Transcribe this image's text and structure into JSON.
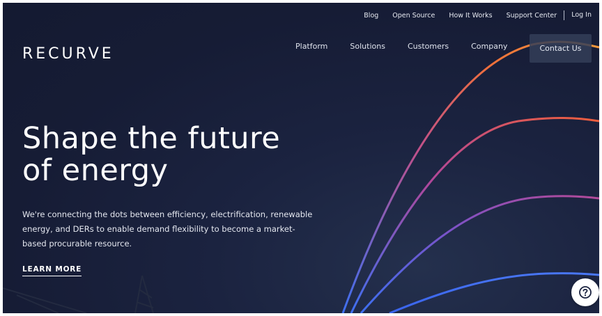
{
  "brand": {
    "logo_text": "RECURVE"
  },
  "utility_nav": {
    "items": [
      {
        "label": "Blog"
      },
      {
        "label": "Open Source"
      },
      {
        "label": "How It Works"
      },
      {
        "label": "Support Center"
      }
    ],
    "login_label": "Log In"
  },
  "main_nav": {
    "items": [
      {
        "label": "Platform"
      },
      {
        "label": "Solutions"
      },
      {
        "label": "Customers"
      },
      {
        "label": "Company"
      }
    ],
    "contact_label": "Contact Us"
  },
  "hero": {
    "title_line1": "Shape the future",
    "title_line2": "of energy",
    "subtitle": "We're connecting the dots between efficiency, electrification, renewable energy, and DERs to enable demand flexibility to become a market-based procurable resource.",
    "cta_label": "LEARN MORE"
  },
  "colors": {
    "background": "#161c35",
    "arc_top": "#f08a3a",
    "arc_second": "#e8573a",
    "arc_third": "#9a4fb8",
    "arc_bottom": "#3d6ff0",
    "text": "#ffffff"
  },
  "icons": {
    "help": "question-circle-icon"
  }
}
